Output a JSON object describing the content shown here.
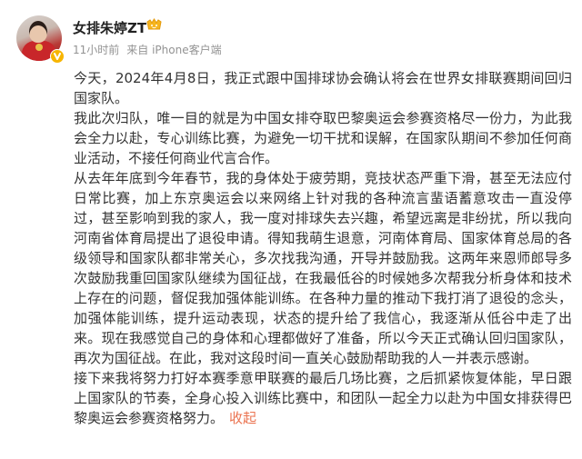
{
  "author": {
    "name": "女排朱婷ZT",
    "badge_icon": "fans-badge-icon",
    "verified_icon": "verified-v-icon"
  },
  "post_meta": {
    "time": "11小时前",
    "source": "来自 iPhone客户端"
  },
  "post": {
    "paragraphs": [
      "今天，2024年4月8日，我正式跟中国排球协会确认将会在世界女排联赛期间回归国家队。",
      "我此次归队，唯一目的就是为中国女排夺取巴黎奥运会参赛资格尽一份力，为此我会全力以赴，专心训练比赛，为避免一切干扰和误解，在国家队期间不参加任何商业活动，不接任何商业代言合作。",
      "从去年年底到今年春节，我的身体处于疲劳期，竞技状态严重下滑，甚至无法应付日常比赛，加上东京奥运会以来网络上针对我的各种流言蜚语蓄意攻击一直没停过，甚至影响到我的家人，我一度对排球失去兴趣，希望远离是非纷扰，所以我向河南省体育局提出了退役申请。得知我萌生退意，河南体育局、国家体育总局的各级领导和国家队都非常关心，多次找我沟通，开导并鼓励我。这两年来恩师郎导多次鼓励我重回国家队继续为国征战，在我最低谷的时候她多次帮我分析身体和技术上存在的问题，督促我加强体能训练。在各种力量的推动下我打消了退役的念头，加强体能训练，提升运动表现，状态的提升给了我信心，我逐渐从低谷中走了出来。现在我感觉自己的身体和心理都做好了准备，所以今天正式确认回归国家队，再次为国征战。在此，我对这段时间一直关心鼓励帮助我的人一并表示感谢。",
      "接下来我将努力打好本赛季意甲联赛的最后几场比赛，之后抓紧恢复体能，早日跟上国家队的节奏，全身心投入训练比赛中，和团队一起全力以赴为中国女排获得巴黎奥运会参赛资格努力。"
    ],
    "collapse_label": "收起"
  },
  "colors": {
    "link_accent": "#eb7350",
    "meta_gray": "#939393",
    "text": "#333333"
  }
}
